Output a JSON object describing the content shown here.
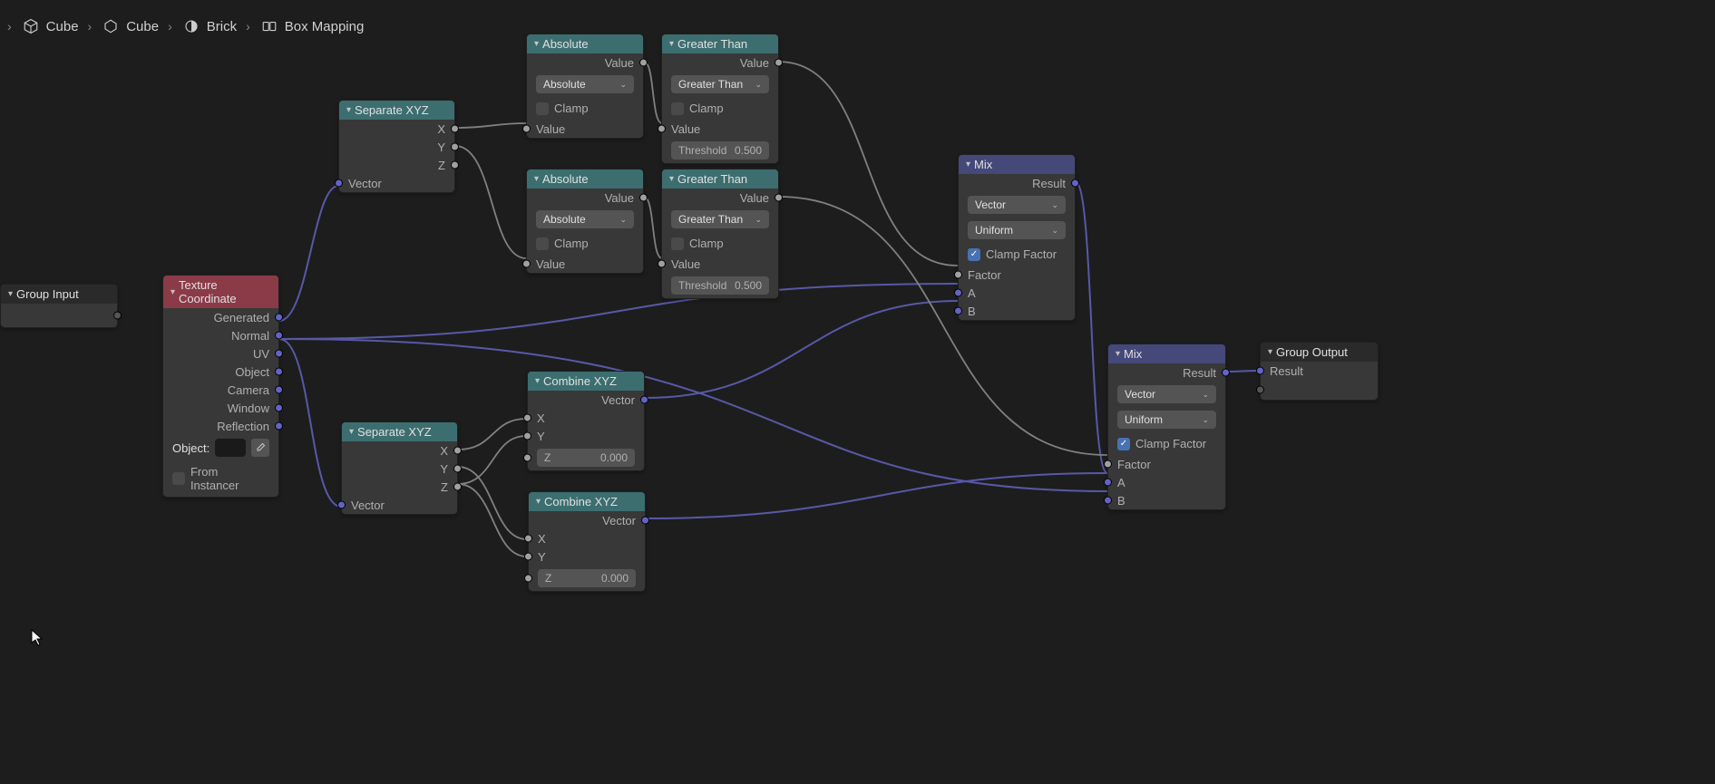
{
  "breadcrumb": [
    {
      "label": "Cube",
      "icon": "cube"
    },
    {
      "label": "Cube",
      "icon": "mesh"
    },
    {
      "label": "Brick",
      "icon": "material"
    },
    {
      "label": "Box Mapping",
      "icon": "nodegroup"
    }
  ],
  "nodes": {
    "group_input": {
      "title": "Group Input",
      "out_blank": ""
    },
    "texture_coordinate": {
      "title": "Texture Coordinate",
      "outputs": [
        "Generated",
        "Normal",
        "UV",
        "Object",
        "Camera",
        "Window",
        "Reflection"
      ],
      "object_label": "Object:",
      "from_instancer": "From Instancer"
    },
    "separate_xyz_1": {
      "title": "Separate XYZ",
      "outputs": [
        "X",
        "Y",
        "Z"
      ],
      "input": "Vector"
    },
    "separate_xyz_2": {
      "title": "Separate XYZ",
      "outputs": [
        "X",
        "Y",
        "Z"
      ],
      "input": "Vector"
    },
    "absolute_1": {
      "title": "Absolute",
      "out_value": "Value",
      "mode": "Absolute",
      "clamp": "Clamp",
      "in_value": "Value"
    },
    "absolute_2": {
      "title": "Absolute",
      "out_value": "Value",
      "mode": "Absolute",
      "clamp": "Clamp",
      "in_value": "Value"
    },
    "greater_1": {
      "title": "Greater Than",
      "out_value": "Value",
      "mode": "Greater Than",
      "clamp": "Clamp",
      "in_value": "Value",
      "threshold_label": "Threshold",
      "threshold_value": "0.500"
    },
    "greater_2": {
      "title": "Greater Than",
      "out_value": "Value",
      "mode": "Greater Than",
      "clamp": "Clamp",
      "in_value": "Value",
      "threshold_label": "Threshold",
      "threshold_value": "0.500"
    },
    "combine_xyz_1": {
      "title": "Combine XYZ",
      "out_vector": "Vector",
      "in_x": "X",
      "in_y": "Y",
      "z_label": "Z",
      "z_value": "0.000"
    },
    "combine_xyz_2": {
      "title": "Combine XYZ",
      "out_vector": "Vector",
      "in_x": "X",
      "in_y": "Y",
      "z_label": "Z",
      "z_value": "0.000"
    },
    "mix_1": {
      "title": "Mix",
      "out_result": "Result",
      "data_type": "Vector",
      "factor_mode": "Uniform",
      "clamp_factor": "Clamp Factor",
      "in_factor": "Factor",
      "in_a": "A",
      "in_b": "B"
    },
    "mix_2": {
      "title": "Mix",
      "out_result": "Result",
      "data_type": "Vector",
      "factor_mode": "Uniform",
      "clamp_factor": "Clamp Factor",
      "in_factor": "Factor",
      "in_a": "A",
      "in_b": "B"
    },
    "group_output": {
      "title": "Group Output",
      "in_result": "Result",
      "in_blank": ""
    }
  }
}
